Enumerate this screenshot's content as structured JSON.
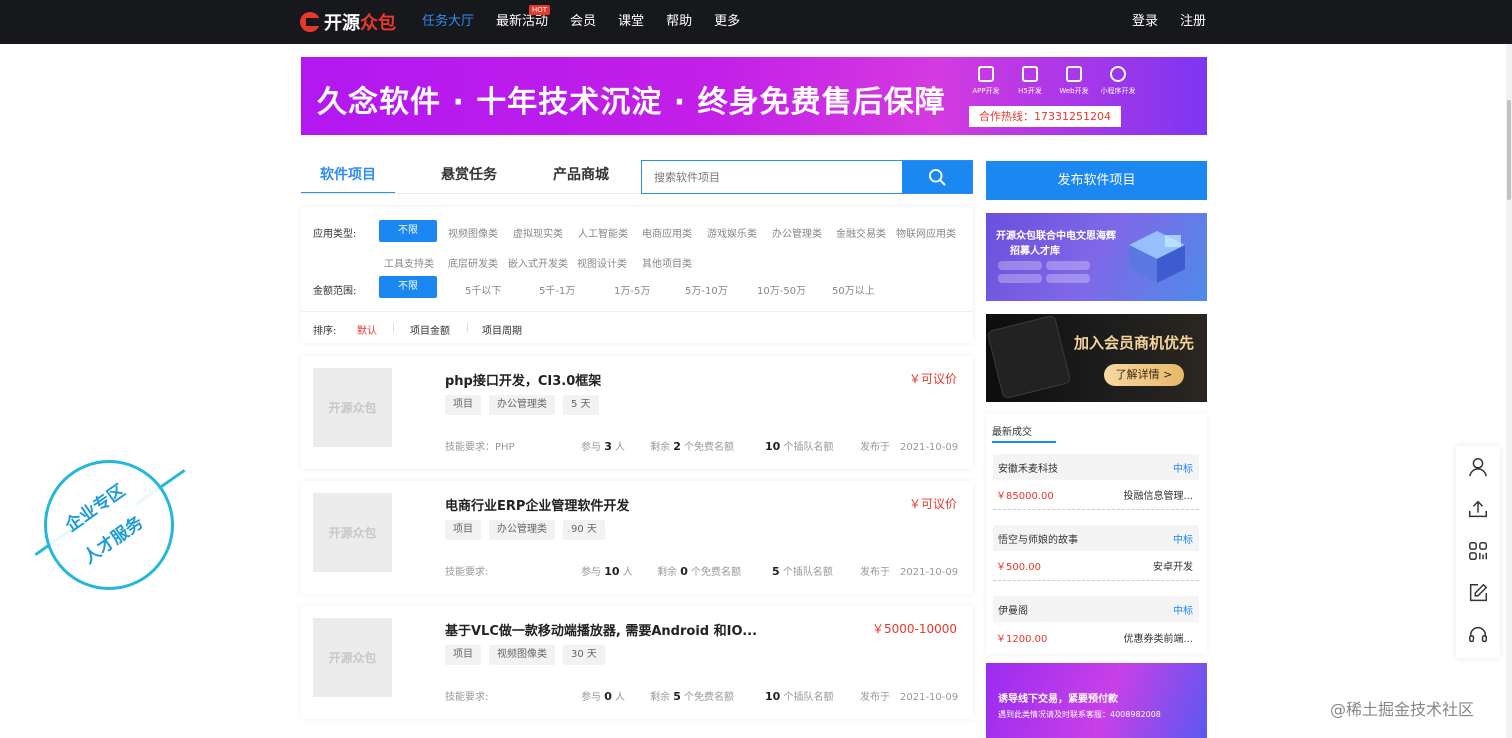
{
  "nav": {
    "logo_primary": "开源",
    "logo_accent": "众包",
    "items": [
      {
        "label": "任务大厅",
        "active": true
      },
      {
        "label": "最新活动",
        "badge": "HOT"
      },
      {
        "label": "会员"
      },
      {
        "label": "课堂"
      },
      {
        "label": "帮助"
      },
      {
        "label": "更多"
      }
    ],
    "login": "登录",
    "register": "注册"
  },
  "banner": {
    "headline": "久念软件 · 十年技术沉淀 · 终身免费售后保障",
    "services": [
      "APP开发",
      "H5开发",
      "Web开发",
      "小程序开发"
    ],
    "hotline": "合作热线：17331251204"
  },
  "tabs": [
    "软件项目",
    "悬赏任务",
    "产品商城"
  ],
  "search": {
    "placeholder": "搜索软件项目"
  },
  "filters": {
    "app_type_label": "应用类型:",
    "app_types_row1": [
      "不限",
      "视频图像类",
      "虚拟现实类",
      "人工智能类",
      "电商应用类",
      "游戏娱乐类",
      "办公管理类",
      "金融交易类",
      "物联网应用类"
    ],
    "app_types_row2": [
      "工具支持类",
      "底层研发类",
      "嵌入式开发类",
      "视图设计类",
      "其他项目类"
    ],
    "amount_label": "金额范围:",
    "amounts": [
      "不限",
      "5千以下",
      "5千-1万",
      "1万-5万",
      "5万-10万",
      "10万-50万",
      "50万以上"
    ],
    "sort_label": "排序:",
    "sort_options": [
      "默认",
      "项目金额",
      "项目周期"
    ]
  },
  "projects": [
    {
      "thumb": "开源众包",
      "title": "php接口开发，CI3.0框架",
      "price": "￥可议价",
      "chips": [
        "项目",
        "办公管理类",
        "5 天"
      ],
      "skills": "技能要求：PHP",
      "join_pre": "参与",
      "join_num": "3",
      "join_post": "人",
      "remain_pre": "剩余",
      "remain_num": "2",
      "remain_post": "个免费名额",
      "team_num": "10",
      "team_post": "个插队名额",
      "published": "发布于　2021-10-09"
    },
    {
      "thumb": "开源众包",
      "title": "电商行业ERP企业管理软件开发",
      "price": "￥可议价",
      "chips": [
        "项目",
        "办公管理类",
        "90 天"
      ],
      "skills": "技能要求:",
      "join_pre": "参与",
      "join_num": "10",
      "join_post": "人",
      "remain_pre": "剩余",
      "remain_num": "0",
      "remain_post": "个免费名额",
      "team_num": "5",
      "team_post": "个插队名额",
      "published": "发布于　2021-10-09"
    },
    {
      "thumb": "开源众包",
      "title": "基于VLC做一款移动端播放器, 需要Android 和IO...",
      "price": "￥5000-10000",
      "chips": [
        "项目",
        "视频图像类",
        "30 天"
      ],
      "skills": "技能要求:",
      "join_pre": "参与",
      "join_num": "0",
      "join_post": "人",
      "remain_pre": "剩余",
      "remain_num": "5",
      "remain_post": "个免费名额",
      "team_num": "10",
      "team_post": "个插队名额",
      "published": "发布于　2021-10-09"
    }
  ],
  "sidebar": {
    "publish": "发布软件项目",
    "ad1_line1": "开源众包联合中电文思海辉",
    "ad1_line2": "招募人才库",
    "ad2_text": "加入会员商机优先",
    "ad2_btn": "了解详情 >",
    "deals_title": "最新成交",
    "deals": [
      {
        "name": "安徽禾麦科技",
        "status": "中标",
        "price": "￥85000.00",
        "desc": "投融信息管理..."
      },
      {
        "name": "悟空与师娘的故事",
        "status": "中标",
        "price": "￥500.00",
        "desc": "安卓开发"
      },
      {
        "name": "伊曼阁",
        "status": "中标",
        "price": "￥1200.00",
        "desc": "优惠券类前端..."
      }
    ],
    "ad3_title": "诱导线下交易，紧要预付款",
    "ad3_sub": "遇到此类情况请及时联系客服：4008982008"
  },
  "badge": {
    "line1": "企业专区",
    "line2": "人才服务"
  },
  "side_tools": [
    "user-icon",
    "upload-icon",
    "qr-code-icon",
    "edit-icon",
    "headset-icon"
  ],
  "watermark": "@稀土掘金技术社区",
  "colors": {
    "accent": "#1b87f0",
    "price": "#e8382c",
    "nav_bg": "#17181c"
  }
}
